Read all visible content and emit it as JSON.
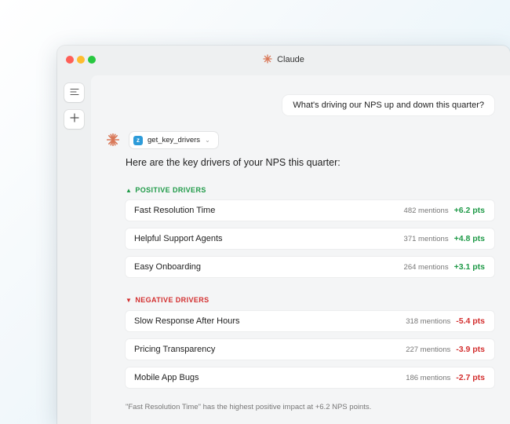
{
  "window": {
    "title": "Claude"
  },
  "chat": {
    "user_message": "What's driving our NPS up and down this quarter?",
    "tool_call": {
      "name": "get_key_drivers",
      "icon": "z"
    },
    "intro": "Here are the key drivers of your NPS this quarter:",
    "positive_label": "POSITIVE DRIVERS",
    "negative_label": "NEGATIVE DRIVERS",
    "positive": [
      {
        "name": "Fast Resolution Time",
        "mentions": "482 mentions",
        "impact": "+6.2 pts"
      },
      {
        "name": "Helpful Support Agents",
        "mentions": "371 mentions",
        "impact": "+4.8 pts"
      },
      {
        "name": "Easy Onboarding",
        "mentions": "264 mentions",
        "impact": "+3.1 pts"
      }
    ],
    "negative": [
      {
        "name": "Slow Response After Hours",
        "mentions": "318 mentions",
        "impact": "-5.4 pts"
      },
      {
        "name": "Pricing Transparency",
        "mentions": "227 mentions",
        "impact": "-3.9 pts"
      },
      {
        "name": "Mobile App Bugs",
        "mentions": "186 mentions",
        "impact": "-2.7 pts"
      }
    ],
    "footer_note": "\"Fast Resolution Time\" has the highest positive impact at +6.2 NPS points."
  },
  "colors": {
    "positive": "#1f9a48",
    "negative": "#d32f2f",
    "brand": "#d97757"
  }
}
